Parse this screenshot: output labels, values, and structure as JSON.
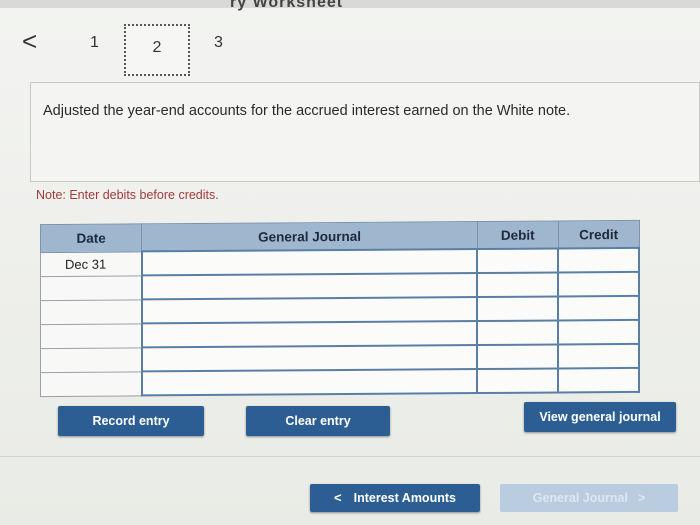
{
  "header": {
    "title_fragment": "ry Worksheet"
  },
  "nav": {
    "back_icon": "chevron-left-icon",
    "back_glyph": "<",
    "tabs": [
      {
        "label": "1",
        "active": false
      },
      {
        "label": "2",
        "active": true
      },
      {
        "label": "3",
        "active": false
      }
    ]
  },
  "question": {
    "text": "Adjusted the year-end accounts for the accrued interest earned on the White note."
  },
  "note": "Note: Enter debits before credits.",
  "table": {
    "headers": {
      "date": "Date",
      "general_journal": "General Journal",
      "debit": "Debit",
      "credit": "Credit"
    },
    "rows": [
      {
        "date": "Dec 31",
        "journal": "",
        "debit": "",
        "credit": ""
      },
      {
        "date": "",
        "journal": "",
        "debit": "",
        "credit": ""
      },
      {
        "date": "",
        "journal": "",
        "debit": "",
        "credit": ""
      },
      {
        "date": "",
        "journal": "",
        "debit": "",
        "credit": ""
      },
      {
        "date": "",
        "journal": "",
        "debit": "",
        "credit": ""
      },
      {
        "date": "",
        "journal": "",
        "debit": "",
        "credit": ""
      }
    ]
  },
  "buttons": {
    "record": "Record entry",
    "clear": "Clear entry",
    "view": "View general journal"
  },
  "footer": {
    "prev_label": "Interest Amounts",
    "prev_glyph": "<",
    "next_label": "General Journal",
    "next_glyph": ">"
  },
  "colors": {
    "primary_button": "#2d5e93",
    "table_header": "#9fb6cf",
    "note_text": "#a33a3a",
    "disabled_button": "#b9cce0"
  }
}
